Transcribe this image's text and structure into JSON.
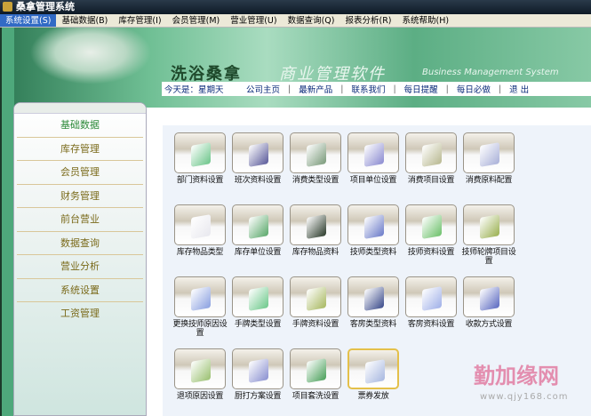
{
  "window": {
    "title": "桑拿管理系统"
  },
  "menu": [
    "系统设置(S)",
    "基础数据(B)",
    "库存管理(I)",
    "会员管理(M)",
    "营业管理(U)",
    "数据查询(Q)",
    "报表分析(R)",
    "系统帮助(H)"
  ],
  "banner": {
    "brand": "洗浴桑拿",
    "subtitle": "商业管理软件",
    "english": "Business Management System"
  },
  "nav": {
    "today": "今天是：星期天",
    "links": [
      "公司主页",
      "最新产品",
      "联系我们",
      "每日提醒",
      "每日必做",
      "退 出"
    ],
    "separator": "|"
  },
  "sidebar": [
    "基础数据",
    "库存管理",
    "会员管理",
    "财务管理",
    "前台营业",
    "数据查询",
    "营业分析",
    "系统设置",
    "工资管理"
  ],
  "tiles": [
    {
      "label": "部门资料设置",
      "icon": "cd-icon",
      "color": "#6cc58a"
    },
    {
      "label": "班次资料设置",
      "icon": "archive-icon",
      "color": "#5a5a9a"
    },
    {
      "label": "消费类型设置",
      "icon": "stack-icon",
      "color": "#7a9a7a"
    },
    {
      "label": "项目单位设置",
      "icon": "book-icon",
      "color": "#8a8ad0"
    },
    {
      "label": "消费项目设置",
      "icon": "folder-icon",
      "color": "#b8b890"
    },
    {
      "label": "消费原料配置",
      "icon": "document-pen-icon",
      "color": "#a9b0d8"
    },
    {
      "label": "库存物品类型",
      "icon": "document-icon",
      "color": "#e8e8ee"
    },
    {
      "label": "库存单位设置",
      "icon": "file-icon",
      "color": "#5aa86a"
    },
    {
      "label": "库存物品资料",
      "icon": "dark-folder-icon",
      "color": "#2a3a2a"
    },
    {
      "label": "技师类型资料",
      "icon": "download-icon",
      "color": "#6a7ac8"
    },
    {
      "label": "技师资料设置",
      "icon": "mail-icon",
      "color": "#6cc06a"
    },
    {
      "label": "技师轮牌项目设置",
      "icon": "document-edit-icon",
      "color": "#9ab050"
    },
    {
      "label": "更换技师原因设置",
      "icon": "gear-icon",
      "color": "#8aa0e0"
    },
    {
      "label": "手牌类型设置",
      "icon": "green-folder-icon",
      "color": "#6cc88a"
    },
    {
      "label": "手牌资料设置",
      "icon": "home-icon",
      "color": "#a8b860"
    },
    {
      "label": "客房类型资料",
      "icon": "film-icon",
      "color": "#3a4a8a"
    },
    {
      "label": "客房资料设置",
      "icon": "papers-icon",
      "color": "#a0b0e8"
    },
    {
      "label": "收款方式设置",
      "icon": "disc-icon",
      "color": "#5a68c0"
    },
    {
      "label": "退项原因设置",
      "icon": "box-icon",
      "color": "#9ac070"
    },
    {
      "label": "厨打方案设置",
      "icon": "printer-icon",
      "color": "#8a90d0"
    },
    {
      "label": "项目套洗设置",
      "icon": "books-icon",
      "color": "#4aa05a"
    },
    {
      "label": "票券发放",
      "icon": "ticket-icon",
      "color": "#a8b8e0"
    }
  ],
  "watermark": {
    "text": "勤加缘网",
    "url": "www.qjy168.com"
  }
}
